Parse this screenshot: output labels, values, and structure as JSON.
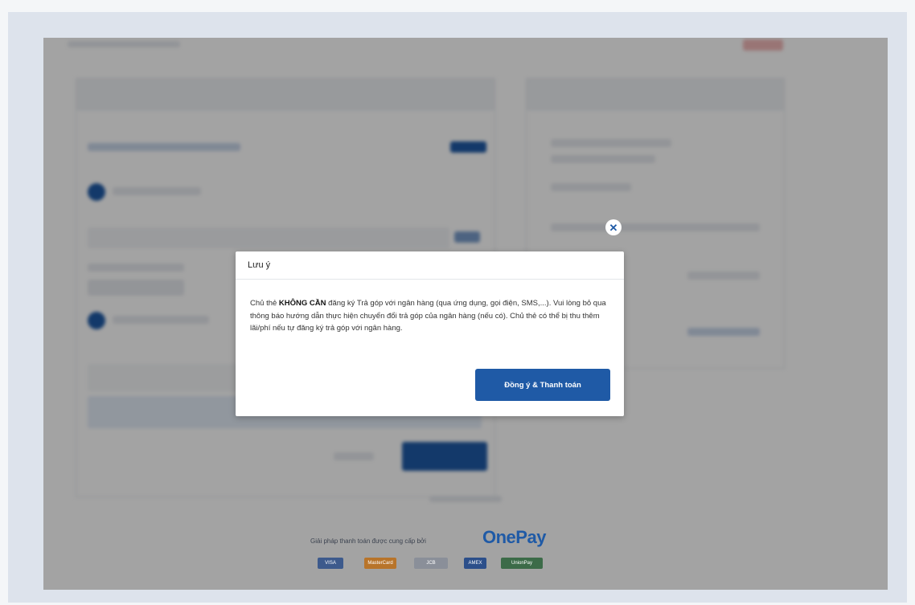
{
  "background": {
    "footer_text": "Giải pháp thanh toán được cung cấp bởi",
    "brand_name": "OnePay",
    "brand_color": "#1f5aa6",
    "card_brands": [
      "VISA",
      "MasterCard",
      "JCB",
      "AMEX",
      "UnionPay"
    ]
  },
  "modal": {
    "title": "Lưu ý",
    "body_prefix": "Chủ thẻ ",
    "body_bold": "KHÔNG CẦN",
    "body_rest": " đăng ký Trả góp với ngân hàng (qua ứng dụng, gọi điện, SMS,...). Vui lòng bỏ qua thông báo hướng dẫn thực hiện chuyển đổi trả góp của ngân hàng (nếu có). Chủ thẻ có thể bị thu thêm lãi/phí nếu tự đăng ký trả góp với ngân hàng.",
    "confirm_label": "Đồng ý & Thanh toán",
    "close_icon": "close-icon"
  }
}
